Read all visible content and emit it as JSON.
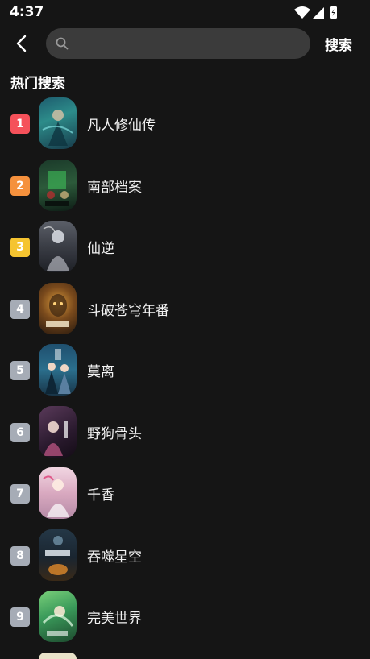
{
  "status_bar": {
    "time": "4:37"
  },
  "header": {
    "search_placeholder": "",
    "search_button": "搜索"
  },
  "section_title": "热门搜索",
  "rank_colors": {
    "1": "#f5515a",
    "2": "#f5913d",
    "3": "#f5c430",
    "other": "#a6acb6"
  },
  "hot_list": [
    {
      "rank": "1",
      "title": "凡人修仙传"
    },
    {
      "rank": "2",
      "title": "南部档案"
    },
    {
      "rank": "3",
      "title": "仙逆"
    },
    {
      "rank": "4",
      "title": "斗破苍穹年番"
    },
    {
      "rank": "5",
      "title": "莫离"
    },
    {
      "rank": "6",
      "title": "野狗骨头"
    },
    {
      "rank": "7",
      "title": "千香"
    },
    {
      "rank": "8",
      "title": "吞噬星空"
    },
    {
      "rank": "9",
      "title": "完美世界"
    }
  ]
}
